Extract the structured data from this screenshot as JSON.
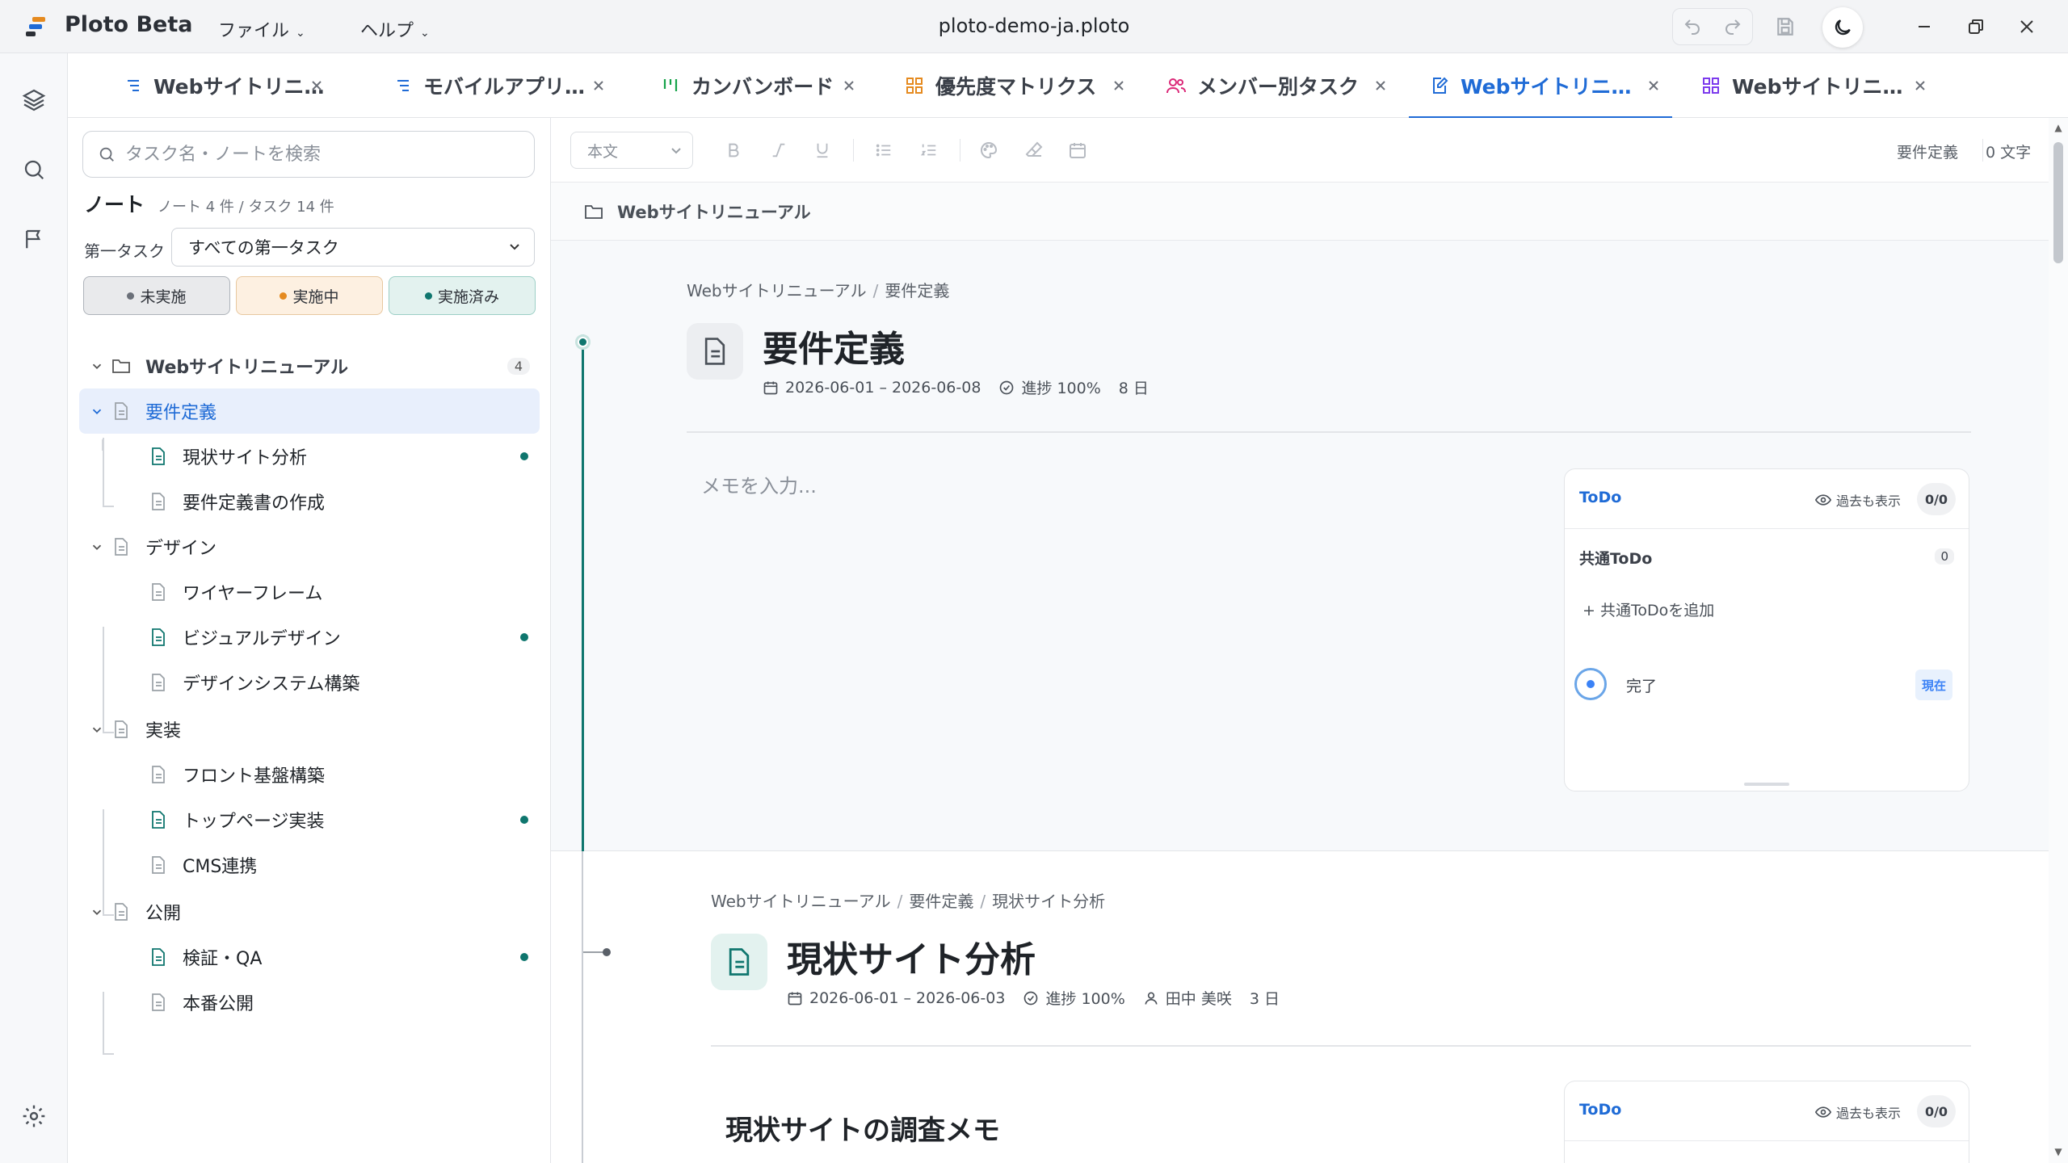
{
  "app": {
    "name": "Ploto Beta",
    "doc_title": "ploto-demo-ja.ploto",
    "menus": [
      "ファイル",
      "ヘルプ"
    ]
  },
  "tabs": [
    {
      "label": "Webサイトリニ…",
      "icon": "list-icon",
      "color": "#1f6bd6",
      "active": false
    },
    {
      "label": "モバイルアプリ…",
      "icon": "list-icon",
      "color": "#1f6bd6",
      "active": false
    },
    {
      "label": "カンバンボード",
      "icon": "kanban-icon",
      "color": "#16a34a",
      "active": false
    },
    {
      "label": "優先度マトリクス",
      "icon": "grid-icon",
      "color": "#e58a1f",
      "active": false
    },
    {
      "label": "メンバー別タスク",
      "icon": "users-icon",
      "color": "#db2777",
      "active": false
    },
    {
      "label": "Webサイトリニ…",
      "icon": "note-edit-icon",
      "color": "#1f6bd6",
      "active": true
    },
    {
      "label": "Webサイトリニ…",
      "icon": "grid-icon",
      "color": "#7c3aed",
      "active": false
    }
  ],
  "sidebar": {
    "search_placeholder": "タスク名・ノートを検索",
    "notes_title": "ノート",
    "notes_summary": "ノート 4 件 / タスク 14 件",
    "filter_label": "第一タスク",
    "filter_value": "すべての第一タスク",
    "status_buttons": [
      {
        "label": "未実施",
        "dot": "#6b7079",
        "bg": "#e9eaec",
        "border": "#aeb3ba"
      },
      {
        "label": "実施中",
        "dot": "#e58a1f",
        "bg": "#fdf0e1",
        "border": "#e8c8a0"
      },
      {
        "label": "実施済み",
        "dot": "#0f766e",
        "bg": "#e3f2ef",
        "border": "#9ccfc6"
      }
    ],
    "tree": {
      "root": {
        "label": "Webサイトリニューアル",
        "count": "4"
      },
      "items": [
        {
          "label": "要件定義",
          "level": 1,
          "selected": true
        },
        {
          "label": "現状サイト分析",
          "level": 2,
          "has_note": true
        },
        {
          "label": "要件定義書の作成",
          "level": 2,
          "has_note": false
        },
        {
          "label": "デザイン",
          "level": 1
        },
        {
          "label": "ワイヤーフレーム",
          "level": 2,
          "has_note": false
        },
        {
          "label": "ビジュアルデザイン",
          "level": 2,
          "has_note": true
        },
        {
          "label": "デザインシステム構築",
          "level": 2,
          "has_note": false
        },
        {
          "label": "実装",
          "level": 1
        },
        {
          "label": "フロント基盤構築",
          "level": 2,
          "has_note": false
        },
        {
          "label": "トップページ実装",
          "level": 2,
          "has_note": true
        },
        {
          "label": "CMS連携",
          "level": 2,
          "has_note": false
        },
        {
          "label": "公開",
          "level": 1
        },
        {
          "label": "検証・QA",
          "level": 2,
          "has_note": true
        },
        {
          "label": "本番公開",
          "level": 2,
          "has_note": false
        }
      ]
    }
  },
  "toolbar": {
    "text_style": "本文",
    "buttons": [
      "bold-icon",
      "italic-icon",
      "underline-icon",
      "bullet-list-icon",
      "numbered-list-icon",
      "palette-icon",
      "eraser-icon",
      "calendar-icon"
    ],
    "current_note": "要件定義",
    "char_count": "0 文字"
  },
  "folder_bar": {
    "label": "Webサイトリニューアル"
  },
  "section1": {
    "breadcrumb": [
      "Webサイトリニューアル",
      "要件定義"
    ],
    "title": "要件定義",
    "date_range": "2026-06-01 – 2026-06-08",
    "progress": "進捗 100%",
    "duration": "8 日",
    "memo_placeholder": "メモを入力...",
    "todo": {
      "title": "ToDo",
      "past_label": "過去も表示",
      "count": "0/0",
      "shared_label": "共通ToDo",
      "shared_count": "0",
      "add_shared": "+ 共通ToDoを追加",
      "done_label": "完了",
      "now_badge": "現在"
    }
  },
  "section2": {
    "breadcrumb": [
      "Webサイトリニューアル",
      "要件定義",
      "現状サイト分析"
    ],
    "title": "現状サイト分析",
    "date_range": "2026-06-01 – 2026-06-03",
    "progress": "進捗 100%",
    "assignee": "田中 美咲",
    "duration": "3 日",
    "heading": "現状サイトの調査メモ",
    "todo": {
      "title": "ToDo",
      "past_label": "過去も表示",
      "count": "0/0"
    }
  },
  "colors": {
    "accent": "#1f6bd6",
    "teal": "#0f766e",
    "orange": "#e58a1f"
  }
}
